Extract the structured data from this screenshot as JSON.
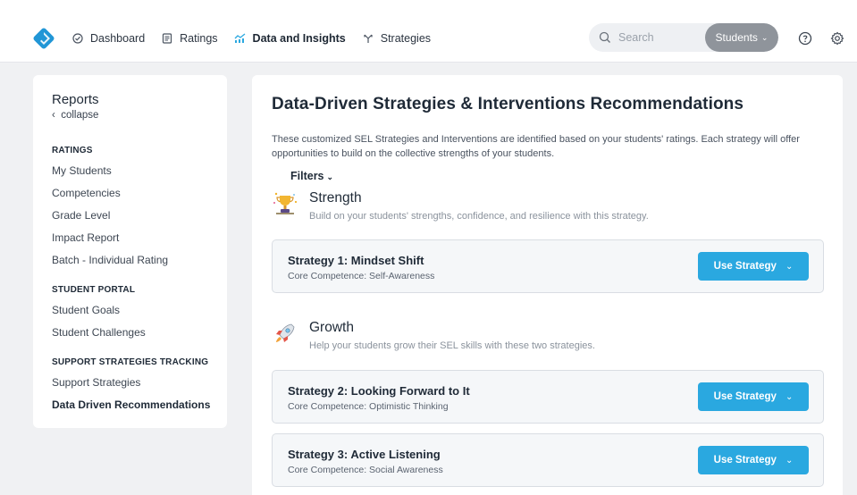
{
  "nav": {
    "items": [
      {
        "label": "Dashboard",
        "icon": "dashboard-icon"
      },
      {
        "label": "Ratings",
        "icon": "ratings-icon"
      },
      {
        "label": "Data and Insights",
        "icon": "insights-icon"
      },
      {
        "label": "Strategies",
        "icon": "strategies-icon"
      }
    ],
    "active": "Data and Insights"
  },
  "search": {
    "placeholder": "Search",
    "scope": "Students"
  },
  "colors": {
    "accent": "#2aa8e0",
    "logo": "#2196d6",
    "scope_bg": "#8f949b"
  },
  "sidebar": {
    "title": "Reports",
    "collapse_label": "collapse",
    "sections": [
      {
        "heading": "RATINGS",
        "items": [
          "My Students",
          "Competencies",
          "Grade Level",
          "Impact Report",
          "Batch - Individual Rating"
        ]
      },
      {
        "heading": "STUDENT PORTAL",
        "items": [
          "Student Goals",
          "Student Challenges"
        ]
      },
      {
        "heading": "SUPPORT STRATEGIES TRACKING",
        "items": [
          "Support Strategies",
          "Data Driven Recommendations"
        ]
      }
    ],
    "active_item": "Data Driven Recommendations"
  },
  "main": {
    "title": "Data-Driven Strategies & Interventions Recommendations",
    "intro": "These customized SEL Strategies and Interventions are identified based on your students' ratings. Each strategy will offer opportunities to build on the collective strengths of your students.",
    "filters_label": "Filters",
    "sections": [
      {
        "title": "Strength",
        "description": "Build on your students' strengths, confidence, and resilience with this strategy.",
        "icon": "trophy-icon",
        "strategies": [
          {
            "title": "Strategy 1: Mindset Shift",
            "competence": "Core Competence: Self-Awareness",
            "button": "Use Strategy"
          }
        ]
      },
      {
        "title": "Growth",
        "description": "Help your students grow their SEL skills with these two strategies.",
        "icon": "rocket-icon",
        "strategies": [
          {
            "title": "Strategy 2: Looking Forward to It",
            "competence": "Core Competence: Optimistic Thinking",
            "button": "Use Strategy"
          },
          {
            "title": "Strategy 3: Active Listening",
            "competence": "Core Competence: Social Awareness",
            "button": "Use Strategy"
          }
        ]
      }
    ]
  }
}
